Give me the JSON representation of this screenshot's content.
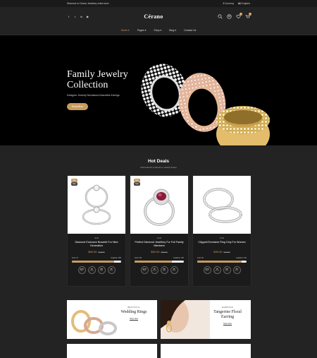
{
  "topbar": {
    "welcome": "Welcome to Cérano Jewellery online store",
    "currency": "$ Currency",
    "language": "English"
  },
  "header": {
    "logo": "Cérano",
    "wishlist_count": "0",
    "cart_count": "0"
  },
  "nav": {
    "items": [
      {
        "label": "Home"
      },
      {
        "label": "Pages"
      },
      {
        "label": "Shop"
      },
      {
        "label": "Blog"
      },
      {
        "label": "Contact Us"
      }
    ]
  },
  "hero": {
    "title": "Family Jewelry Collection",
    "subtitle": "Designer Jewelry Necklaces-Bracelets-Earings",
    "button": "Read More"
  },
  "hot_deals": {
    "title": "Hot Deals",
    "subtitle": "Add featured products to weekly lineup",
    "cards": [
      {
        "tag_new": "New",
        "tag_sale": "Sale",
        "category": "Gold",
        "name": "Diamond Exclusive Bracelet For Nine Generation",
        "price": "$80.00",
        "old_price": "$90.00",
        "sold": "Sold: 15",
        "available": "Available: 585",
        "sold_fraction": 0.85,
        "timer": [
          {
            "n": "220",
            "l": "DAYS"
          },
          {
            "n": "15",
            "l": "HOURS"
          },
          {
            "n": "08",
            "l": "MINS"
          },
          {
            "n": "45",
            "l": "SECS"
          }
        ]
      },
      {
        "tag_new": "New",
        "tag_sale": "Sale",
        "category": "Gold",
        "name": "Perfect Diamond Jewellery For Full Family Members",
        "price": "$50.00",
        "old_price": "$56.00",
        "sold": "Sold: 150",
        "available": "Available: 250",
        "sold_fraction": 0.75,
        "timer": [
          {
            "n": "220",
            "l": "DAYS"
          },
          {
            "n": "15",
            "l": "HOURS"
          },
          {
            "n": "08",
            "l": "MINS"
          },
          {
            "n": "45",
            "l": "SECS"
          }
        ]
      },
      {
        "tag_new": "",
        "tag_sale": "",
        "category": "Gold",
        "name": "Citygold Exclusive Ring Only For Women",
        "price": "$30.00",
        "old_price": "$40.00",
        "sold": "Sold: 90",
        "available": "Available: 520",
        "sold_fraction": 0.9,
        "timer": [
          {
            "n": "220",
            "l": "DAYS"
          },
          {
            "n": "15",
            "l": "HOURS"
          },
          {
            "n": "08",
            "l": "MINS"
          },
          {
            "n": "45",
            "l": "SECS"
          }
        ]
      }
    ]
  },
  "banners": [
    {
      "small": "BEAUTIFUL",
      "big": "Wedding Rings",
      "link": "Shop Now"
    },
    {
      "small": "EARRINGS",
      "big": "Tangerine Floral Earring",
      "link": "Shop Now"
    }
  ],
  "colors": {
    "accent": "#c89b5d",
    "background": "#232323",
    "hero": "#000000"
  }
}
